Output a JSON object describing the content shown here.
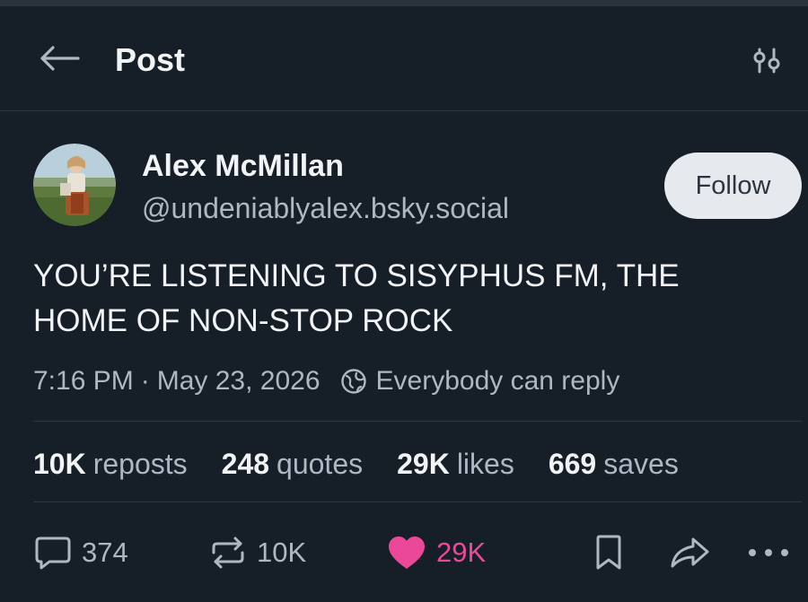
{
  "header": {
    "title": "Post",
    "back_icon": "arrow-left-icon",
    "settings_icon": "sliders-icon"
  },
  "author": {
    "name": "Alex McMillan",
    "handle": "@undeniablyalex.bsky.social",
    "avatar_icon": "avatar-photo",
    "follow_label": "Follow"
  },
  "post": {
    "text_lines": [
      "YOU’RE LISTENING TO SISYPHUS FM, THE",
      "HOME OF NON-STOP ROCK"
    ],
    "time": "7:16 PM",
    "separator": "·",
    "date": "May 23, 2026",
    "reply_scope": "Everybody can reply",
    "reply_scope_icon": "globe-icon"
  },
  "stats": [
    {
      "value": "10K",
      "label": "reposts"
    },
    {
      "value": "248",
      "label": "quotes"
    },
    {
      "value": "29K",
      "label": "likes"
    },
    {
      "value": "669",
      "label": "saves"
    }
  ],
  "actions": {
    "reply": {
      "icon": "reply-bubble-icon",
      "count": "374"
    },
    "repost": {
      "icon": "repost-icon",
      "count": "10K"
    },
    "like": {
      "icon": "heart-icon",
      "count": "29K",
      "liked": true
    },
    "bookmark": {
      "icon": "bookmark-icon"
    },
    "share": {
      "icon": "share-arrow-icon"
    },
    "more": {
      "icon": "more-dots-icon"
    }
  },
  "colors": {
    "background": "#161e27",
    "text_primary": "#f1f3f5",
    "text_secondary": "#aeb8c4",
    "like_pink": "#ec4899",
    "follow_button_bg": "#e6eaee"
  }
}
